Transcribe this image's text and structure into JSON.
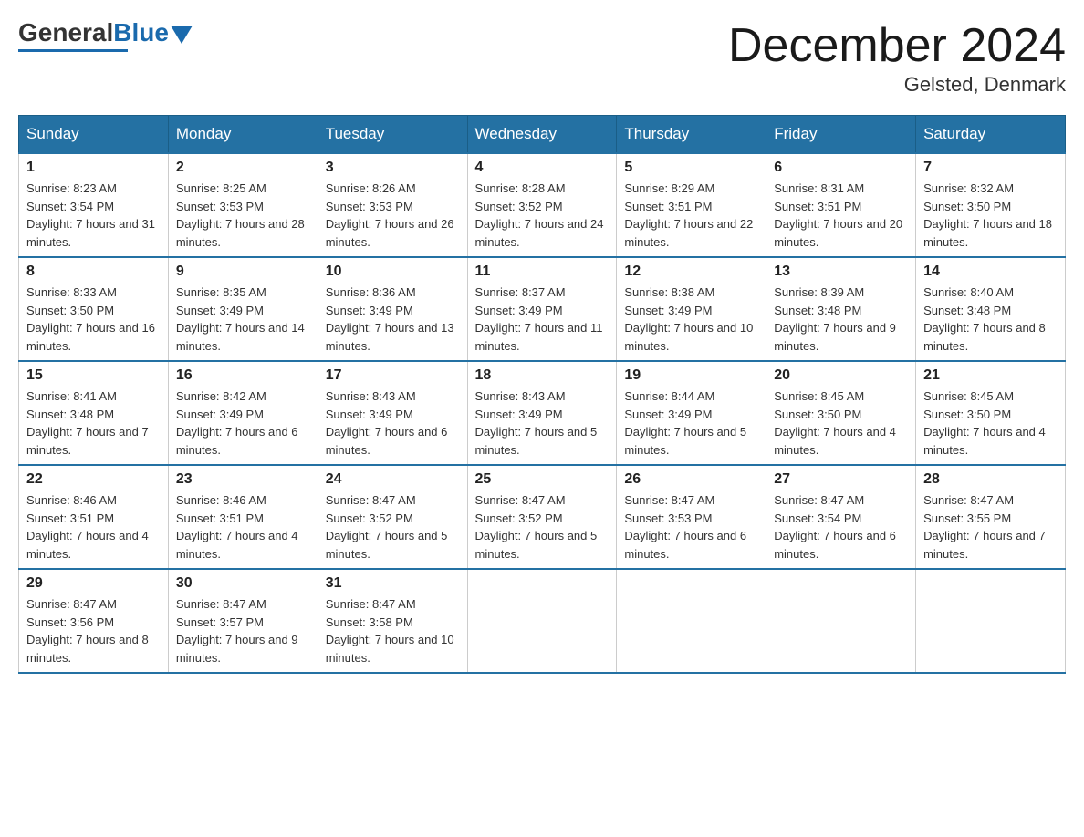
{
  "header": {
    "logo": {
      "general": "General",
      "blue": "Blue"
    },
    "title": "December 2024",
    "location": "Gelsted, Denmark"
  },
  "calendar": {
    "weekdays": [
      "Sunday",
      "Monday",
      "Tuesday",
      "Wednesday",
      "Thursday",
      "Friday",
      "Saturday"
    ],
    "weeks": [
      [
        {
          "day": "1",
          "sunrise": "8:23 AM",
          "sunset": "3:54 PM",
          "daylight": "7 hours and 31 minutes."
        },
        {
          "day": "2",
          "sunrise": "8:25 AM",
          "sunset": "3:53 PM",
          "daylight": "7 hours and 28 minutes."
        },
        {
          "day": "3",
          "sunrise": "8:26 AM",
          "sunset": "3:53 PM",
          "daylight": "7 hours and 26 minutes."
        },
        {
          "day": "4",
          "sunrise": "8:28 AM",
          "sunset": "3:52 PM",
          "daylight": "7 hours and 24 minutes."
        },
        {
          "day": "5",
          "sunrise": "8:29 AM",
          "sunset": "3:51 PM",
          "daylight": "7 hours and 22 minutes."
        },
        {
          "day": "6",
          "sunrise": "8:31 AM",
          "sunset": "3:51 PM",
          "daylight": "7 hours and 20 minutes."
        },
        {
          "day": "7",
          "sunrise": "8:32 AM",
          "sunset": "3:50 PM",
          "daylight": "7 hours and 18 minutes."
        }
      ],
      [
        {
          "day": "8",
          "sunrise": "8:33 AM",
          "sunset": "3:50 PM",
          "daylight": "7 hours and 16 minutes."
        },
        {
          "day": "9",
          "sunrise": "8:35 AM",
          "sunset": "3:49 PM",
          "daylight": "7 hours and 14 minutes."
        },
        {
          "day": "10",
          "sunrise": "8:36 AM",
          "sunset": "3:49 PM",
          "daylight": "7 hours and 13 minutes."
        },
        {
          "day": "11",
          "sunrise": "8:37 AM",
          "sunset": "3:49 PM",
          "daylight": "7 hours and 11 minutes."
        },
        {
          "day": "12",
          "sunrise": "8:38 AM",
          "sunset": "3:49 PM",
          "daylight": "7 hours and 10 minutes."
        },
        {
          "day": "13",
          "sunrise": "8:39 AM",
          "sunset": "3:48 PM",
          "daylight": "7 hours and 9 minutes."
        },
        {
          "day": "14",
          "sunrise": "8:40 AM",
          "sunset": "3:48 PM",
          "daylight": "7 hours and 8 minutes."
        }
      ],
      [
        {
          "day": "15",
          "sunrise": "8:41 AM",
          "sunset": "3:48 PM",
          "daylight": "7 hours and 7 minutes."
        },
        {
          "day": "16",
          "sunrise": "8:42 AM",
          "sunset": "3:49 PM",
          "daylight": "7 hours and 6 minutes."
        },
        {
          "day": "17",
          "sunrise": "8:43 AM",
          "sunset": "3:49 PM",
          "daylight": "7 hours and 6 minutes."
        },
        {
          "day": "18",
          "sunrise": "8:43 AM",
          "sunset": "3:49 PM",
          "daylight": "7 hours and 5 minutes."
        },
        {
          "day": "19",
          "sunrise": "8:44 AM",
          "sunset": "3:49 PM",
          "daylight": "7 hours and 5 minutes."
        },
        {
          "day": "20",
          "sunrise": "8:45 AM",
          "sunset": "3:50 PM",
          "daylight": "7 hours and 4 minutes."
        },
        {
          "day": "21",
          "sunrise": "8:45 AM",
          "sunset": "3:50 PM",
          "daylight": "7 hours and 4 minutes."
        }
      ],
      [
        {
          "day": "22",
          "sunrise": "8:46 AM",
          "sunset": "3:51 PM",
          "daylight": "7 hours and 4 minutes."
        },
        {
          "day": "23",
          "sunrise": "8:46 AM",
          "sunset": "3:51 PM",
          "daylight": "7 hours and 4 minutes."
        },
        {
          "day": "24",
          "sunrise": "8:47 AM",
          "sunset": "3:52 PM",
          "daylight": "7 hours and 5 minutes."
        },
        {
          "day": "25",
          "sunrise": "8:47 AM",
          "sunset": "3:52 PM",
          "daylight": "7 hours and 5 minutes."
        },
        {
          "day": "26",
          "sunrise": "8:47 AM",
          "sunset": "3:53 PM",
          "daylight": "7 hours and 6 minutes."
        },
        {
          "day": "27",
          "sunrise": "8:47 AM",
          "sunset": "3:54 PM",
          "daylight": "7 hours and 6 minutes."
        },
        {
          "day": "28",
          "sunrise": "8:47 AM",
          "sunset": "3:55 PM",
          "daylight": "7 hours and 7 minutes."
        }
      ],
      [
        {
          "day": "29",
          "sunrise": "8:47 AM",
          "sunset": "3:56 PM",
          "daylight": "7 hours and 8 minutes."
        },
        {
          "day": "30",
          "sunrise": "8:47 AM",
          "sunset": "3:57 PM",
          "daylight": "7 hours and 9 minutes."
        },
        {
          "day": "31",
          "sunrise": "8:47 AM",
          "sunset": "3:58 PM",
          "daylight": "7 hours and 10 minutes."
        },
        null,
        null,
        null,
        null
      ]
    ]
  }
}
